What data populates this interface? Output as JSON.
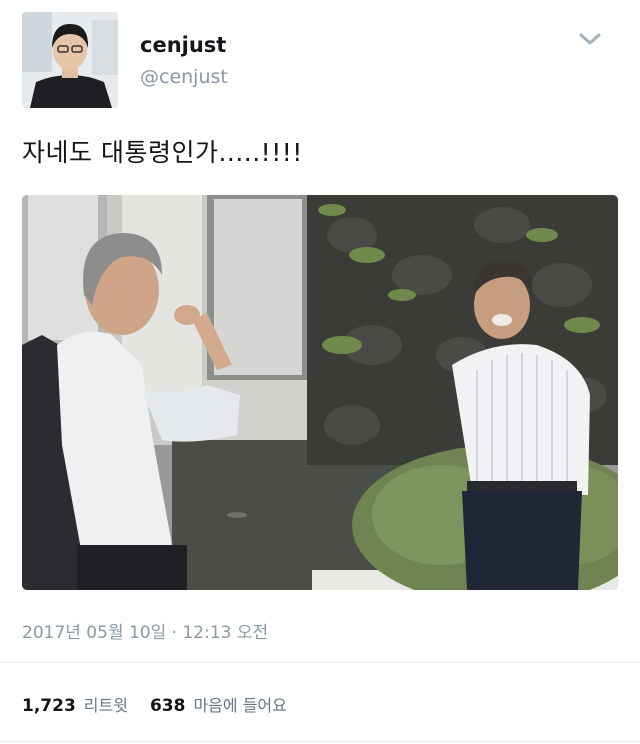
{
  "tweet": {
    "display_name": "cenjust",
    "handle": "@cenjust",
    "text": "자네도 대통령인가.....!!!!",
    "timestamp": "2017년 05월 10일 · 12:13 오전",
    "retweets_count": "1,723",
    "retweets_label": "리트윗",
    "likes_count": "638",
    "likes_label": "마음에 들어요"
  },
  "icons": {
    "menu": "chevron-down-icon"
  }
}
